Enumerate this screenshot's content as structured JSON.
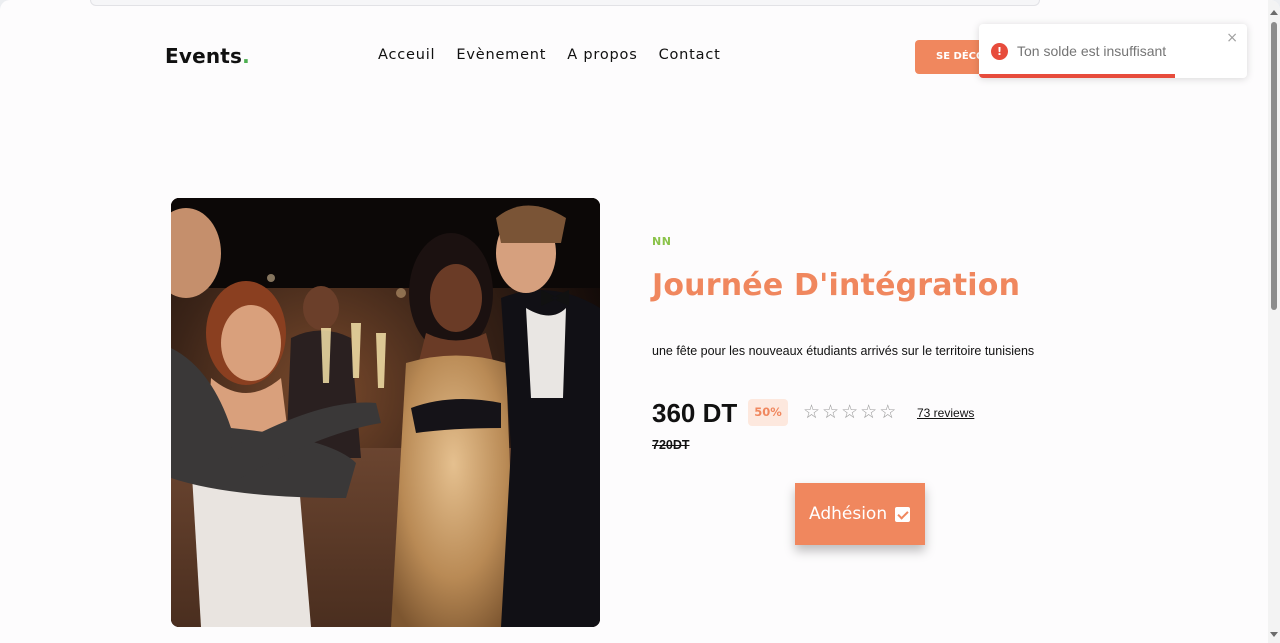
{
  "header": {
    "logo_text": "Events",
    "logo_dot": ".",
    "nav": [
      "Acceuil",
      "Evènement",
      "A propos",
      "Contact"
    ],
    "logout_label": "SE DÉCONNECTER"
  },
  "toast": {
    "icon": "error-icon",
    "message": "Ton solde est insuffisant",
    "close_symbol": "×",
    "progress": 0.73
  },
  "event": {
    "organizer": "NN",
    "title": "Journée D'intégration",
    "description": "une fête pour les nouveaux étudiants arrivés sur le territoire tunisiens",
    "price": "360 DT",
    "discount": "50%",
    "rating": 0,
    "rating_max": 5,
    "reviews": "73 reviews",
    "old_price": "720DT",
    "join_label": "Adhésion"
  },
  "colors": {
    "accent": "#f0875e",
    "organizer": "#8bc34a",
    "error": "#e74c3c"
  }
}
